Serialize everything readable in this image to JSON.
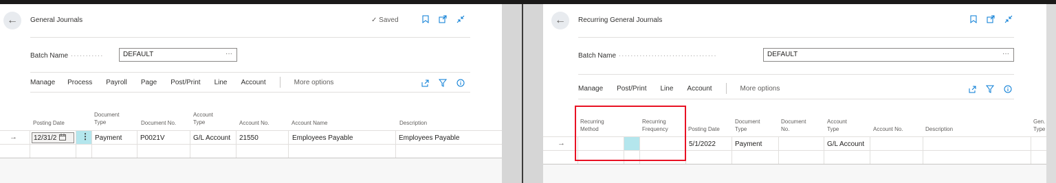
{
  "left": {
    "title": "General Journals",
    "saved_label": "Saved",
    "batch_label": "Batch Name",
    "batch_value": "DEFAULT",
    "batch_more": "···",
    "actions": [
      "Manage",
      "Process",
      "Payroll",
      "Page",
      "Post/Print",
      "Line",
      "Account"
    ],
    "more_options": "More options",
    "columns": {
      "posting_date": "Posting Date",
      "document_type": "Document Type",
      "document_no": "Document No.",
      "account_type": "Account Type",
      "account_no": "Account No.",
      "account_name": "Account Name",
      "description": "Description"
    },
    "row": {
      "posting_date": "12/31/2",
      "document_type": "Payment",
      "document_no": "P0021V",
      "account_type": "G/L Account",
      "account_no": "21550",
      "account_name": "Employees Payable",
      "description": "Employees Payable"
    }
  },
  "right": {
    "title": "Recurring General Journals",
    "batch_label": "Batch Name",
    "batch_value": "DEFAULT",
    "batch_more": "···",
    "actions": [
      "Manage",
      "Post/Print",
      "Line",
      "Account"
    ],
    "more_options": "More options",
    "columns": {
      "recurring_method": "Recurring Method",
      "recurring_frequency": "Recurring Frequency",
      "posting_date": "Posting Date",
      "document_type": "Document Type",
      "document_no": "Document No.",
      "account_type": "Account Type",
      "account_no": "Account No.",
      "description": "Description",
      "gen_type": "Gen. Type"
    },
    "row": {
      "posting_date": "5/1/2022",
      "document_type": "Payment",
      "account_type": "G/L Account"
    }
  },
  "icons": [
    "back-arrow-icon",
    "checkmark-icon",
    "bookmark-icon",
    "open-new-window-icon",
    "collapse-icon",
    "share-icon",
    "filter-icon",
    "info-icon",
    "calendar-icon",
    "row-arrow-icon",
    "kebab-icon"
  ],
  "colors": {
    "accent": "#0078d4",
    "highlight": "#b4e6ed",
    "annotation": "#e81123"
  }
}
